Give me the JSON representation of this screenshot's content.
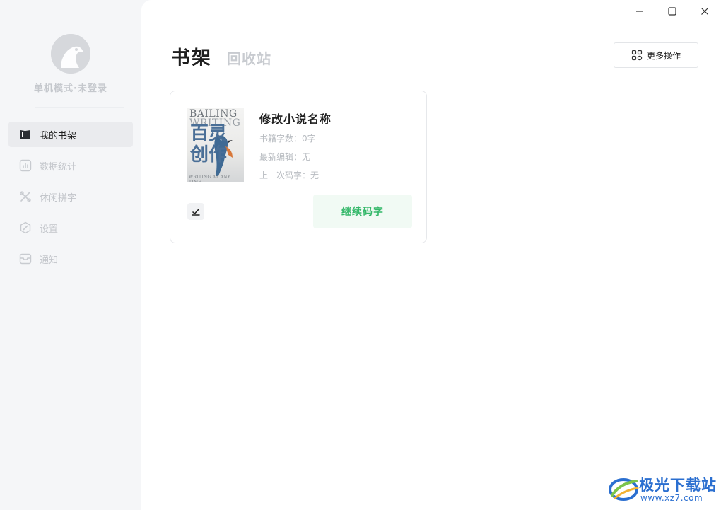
{
  "sidebar": {
    "user_label": "单机模式·未登录",
    "items": [
      {
        "label": "我的书架",
        "icon": "book-icon",
        "active": true
      },
      {
        "label": "数据统计",
        "icon": "chart-icon",
        "active": false
      },
      {
        "label": "休闲拼字",
        "icon": "puzzle-icon",
        "active": false
      },
      {
        "label": "设置",
        "icon": "settings-icon",
        "active": false
      },
      {
        "label": "通知",
        "icon": "inbox-icon",
        "active": false
      }
    ]
  },
  "header": {
    "tab_bookshelf": "书架",
    "tab_recycle": "回收站",
    "more_button": "更多操作"
  },
  "book": {
    "title": "修改小说名称",
    "word_count": "书籍字数：0字",
    "last_edit": "最新编辑：无",
    "last_typing": "上一次码字：无",
    "continue_button": "继续码字",
    "cover": {
      "line1": "BAILING",
      "line2": "WRITING",
      "cn1": "百灵",
      "cn2": "创作",
      "footer": "WRITING AT ANY TIME"
    }
  },
  "watermark": {
    "name": "极光下载站",
    "url": "www.xz7.com"
  },
  "colors": {
    "accent_green": "#35b86a",
    "watermark_blue": "#2b6fd0",
    "sidebar_bg": "#f5f6f8"
  }
}
